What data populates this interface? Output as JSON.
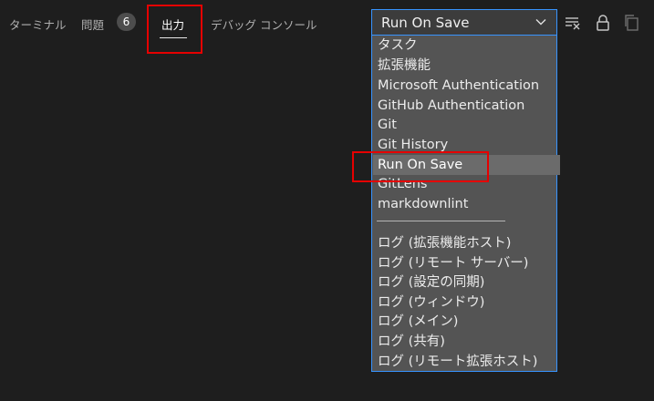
{
  "panel": {
    "tabs": [
      {
        "label": "ターミナル"
      },
      {
        "label": "問題"
      },
      {
        "label": "出力"
      },
      {
        "label": "デバッグ コンソール"
      }
    ],
    "problems_count": "6",
    "active_tab": "出力"
  },
  "output_select": {
    "value": "Run On Save",
    "options": [
      "タスク",
      "拡張機能",
      "Microsoft Authentication",
      "GitHub Authentication",
      "Git",
      "Git History",
      "Run On Save",
      "GitLens",
      "markdownlint",
      "ログ (拡張機能ホスト)",
      "ログ (リモート サーバー)",
      "ログ (設定の同期)",
      "ログ (ウィンドウ)",
      "ログ (メイン)",
      "ログ (共有)",
      "ログ (リモート拡張ホスト)"
    ]
  },
  "icons": {
    "clear": "clear-output-icon",
    "lock": "lock-icon",
    "copy": "copy-icon"
  },
  "colors": {
    "background": "#1e1e1e",
    "dropdown_bg": "#545454",
    "focus_border": "#3794ff",
    "annotation": "#e50000"
  }
}
